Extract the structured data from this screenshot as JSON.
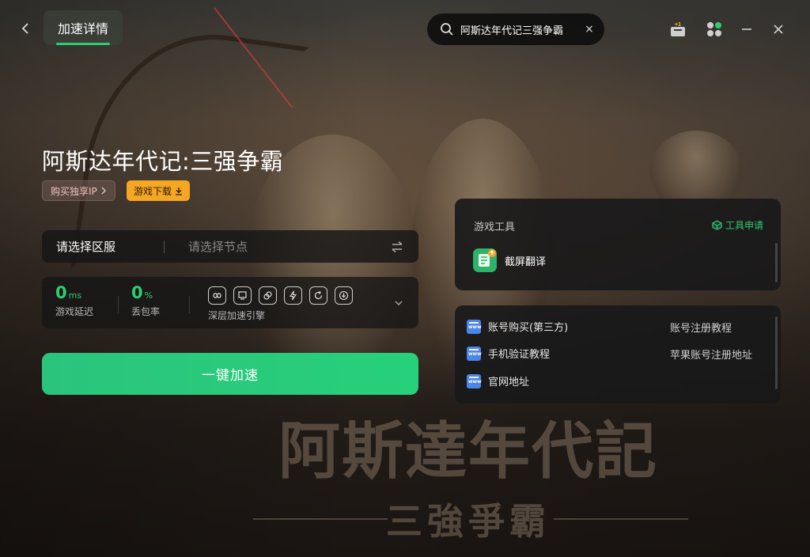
{
  "header": {
    "active_tab": "加速详情",
    "search_value": "阿斯达年代记三强争霸",
    "clear_symbol": "×"
  },
  "game": {
    "title": "阿斯达年代记:三强争霸",
    "buy_ip_label": "购买独享IP",
    "download_label": "游戏下载"
  },
  "selector": {
    "region_label": "请选择区服",
    "node_placeholder": "请选择节点"
  },
  "stats": {
    "latency_value": "0",
    "latency_unit": "ms",
    "latency_label": "游戏延迟",
    "loss_value": "0",
    "loss_unit": "%",
    "loss_label": "丢包率",
    "engine_label": "深层加速引擎",
    "engine_icons": [
      "loop-icon",
      "screen-icon",
      "link-icon",
      "bolt-icon",
      "refresh-icon",
      "download-circle-icon"
    ]
  },
  "accelerate_label": "一键加速",
  "tools": {
    "header": "游戏工具",
    "apply_label": "工具申请",
    "items": [
      {
        "label": "截屏翻译",
        "icon": "screenshot-translate-icon"
      }
    ]
  },
  "links": {
    "left": [
      "账号购买(第三方)",
      "手机验证教程",
      "官网地址"
    ],
    "right": [
      "账号注册教程",
      "苹果账号注册地址"
    ]
  },
  "artwork": {
    "logo_main": "阿斯達年代記",
    "logo_sub": "三強爭霸"
  },
  "colors": {
    "accent": "#2ecc71",
    "download_button": "#f5a623",
    "link_icon": "#4a86e8"
  }
}
